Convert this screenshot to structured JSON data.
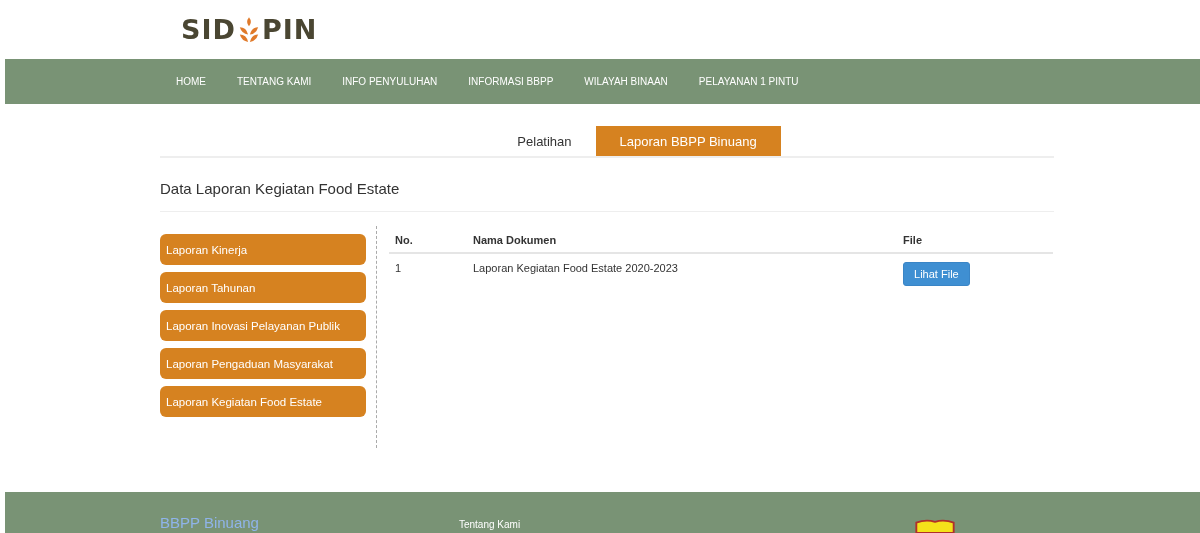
{
  "logo": {
    "left": "SID",
    "right": "PIN"
  },
  "nav": [
    "HOME",
    "TENTANG KAMI",
    "INFO PENYULUHAN",
    "INFORMASI BBPP",
    "WILAYAH BINAAN",
    "PELAYANAN 1 PINTU"
  ],
  "tabs": [
    {
      "label": "Pelatihan",
      "selected": false
    },
    {
      "label": "Laporan BBPP Binuang",
      "selected": true
    }
  ],
  "section_title": "Data Laporan Kegiatan Food Estate",
  "sidebar": {
    "items": [
      "Laporan Kinerja",
      "Laporan Tahunan",
      "Laporan Inovasi Pelayanan Publik",
      "Laporan Pengaduan Masyarakat",
      "Laporan Kegiatan Food Estate"
    ]
  },
  "table": {
    "columns": [
      "No.",
      "Nama Dokumen",
      "File"
    ],
    "rows": [
      {
        "no": "1",
        "name": "Laporan Kegiatan Food Estate 2020-2023",
        "button": "Lihat File"
      }
    ]
  },
  "footer": {
    "title": "BBPP Binuang",
    "link": "Tentang Kami"
  }
}
